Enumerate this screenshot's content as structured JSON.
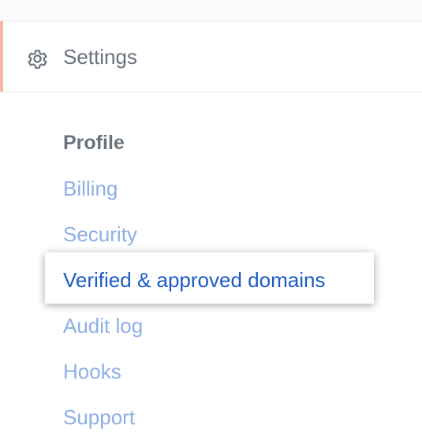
{
  "settings_header": {
    "label": "Settings",
    "icon": "gear-icon"
  },
  "menu": {
    "heading": "Profile",
    "items": [
      {
        "label": "Billing",
        "active": false
      },
      {
        "label": "Security",
        "active": false
      },
      {
        "label": "Verified & approved domains",
        "active": true
      },
      {
        "label": "Audit log",
        "active": false
      },
      {
        "label": "Hooks",
        "active": false
      },
      {
        "label": "Support",
        "active": false
      }
    ]
  },
  "colors": {
    "accent": "#f3b9a8",
    "link": "#8eaee6",
    "active_link": "#1e5bc4",
    "muted_text": "#6a737d"
  }
}
